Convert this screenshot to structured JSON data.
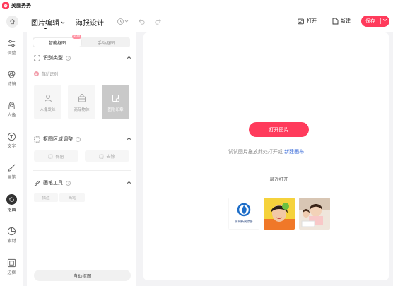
{
  "app": {
    "title": "美图秀秀"
  },
  "toolbar": {
    "tab_edit": "图片编辑",
    "tab_poster": "海报设计",
    "open_label": "打开",
    "new_label": "新建",
    "save_label": "保存"
  },
  "nav": {
    "items": [
      {
        "label": "调整",
        "icon": "sliders-icon"
      },
      {
        "label": "滤镜",
        "icon": "filter-icon"
      },
      {
        "label": "人像",
        "icon": "portrait-icon"
      },
      {
        "label": "文字",
        "icon": "text-icon"
      },
      {
        "label": "画笔",
        "icon": "brush-icon"
      },
      {
        "label": "抠图",
        "icon": "cutout-icon"
      },
      {
        "label": "素材",
        "icon": "sticker-icon"
      },
      {
        "label": "边框",
        "icon": "frame-icon"
      }
    ]
  },
  "panel": {
    "seg_smart": "智能抠图",
    "seg_badge": "NEW",
    "seg_manual": "手动抠图",
    "recognize_title": "识别类型",
    "auto_detect": "自动识别",
    "cards": [
      {
        "label": "人像发丝"
      },
      {
        "label": "商品物体"
      },
      {
        "label": "图形印章"
      }
    ],
    "region_title": "抠图区域调整",
    "keep_btn": "保留",
    "erase_btn": "去除",
    "brush_title": "画笔工具",
    "brush_size": "描边",
    "brush_opacity": "画笔",
    "bottom_btn": "自动抠图"
  },
  "main": {
    "open_btn": "打开图片",
    "hint_text": "试试图片拖放此处打开或",
    "hint_link": "新建画布",
    "recent_label": "最近打开",
    "thumbs": [
      {
        "caption": "苏州新闻综合"
      },
      {
        "caption": ""
      },
      {
        "caption": ""
      }
    ]
  },
  "colors": {
    "accent": "#ff3b5c",
    "link": "#3b6cd9"
  }
}
